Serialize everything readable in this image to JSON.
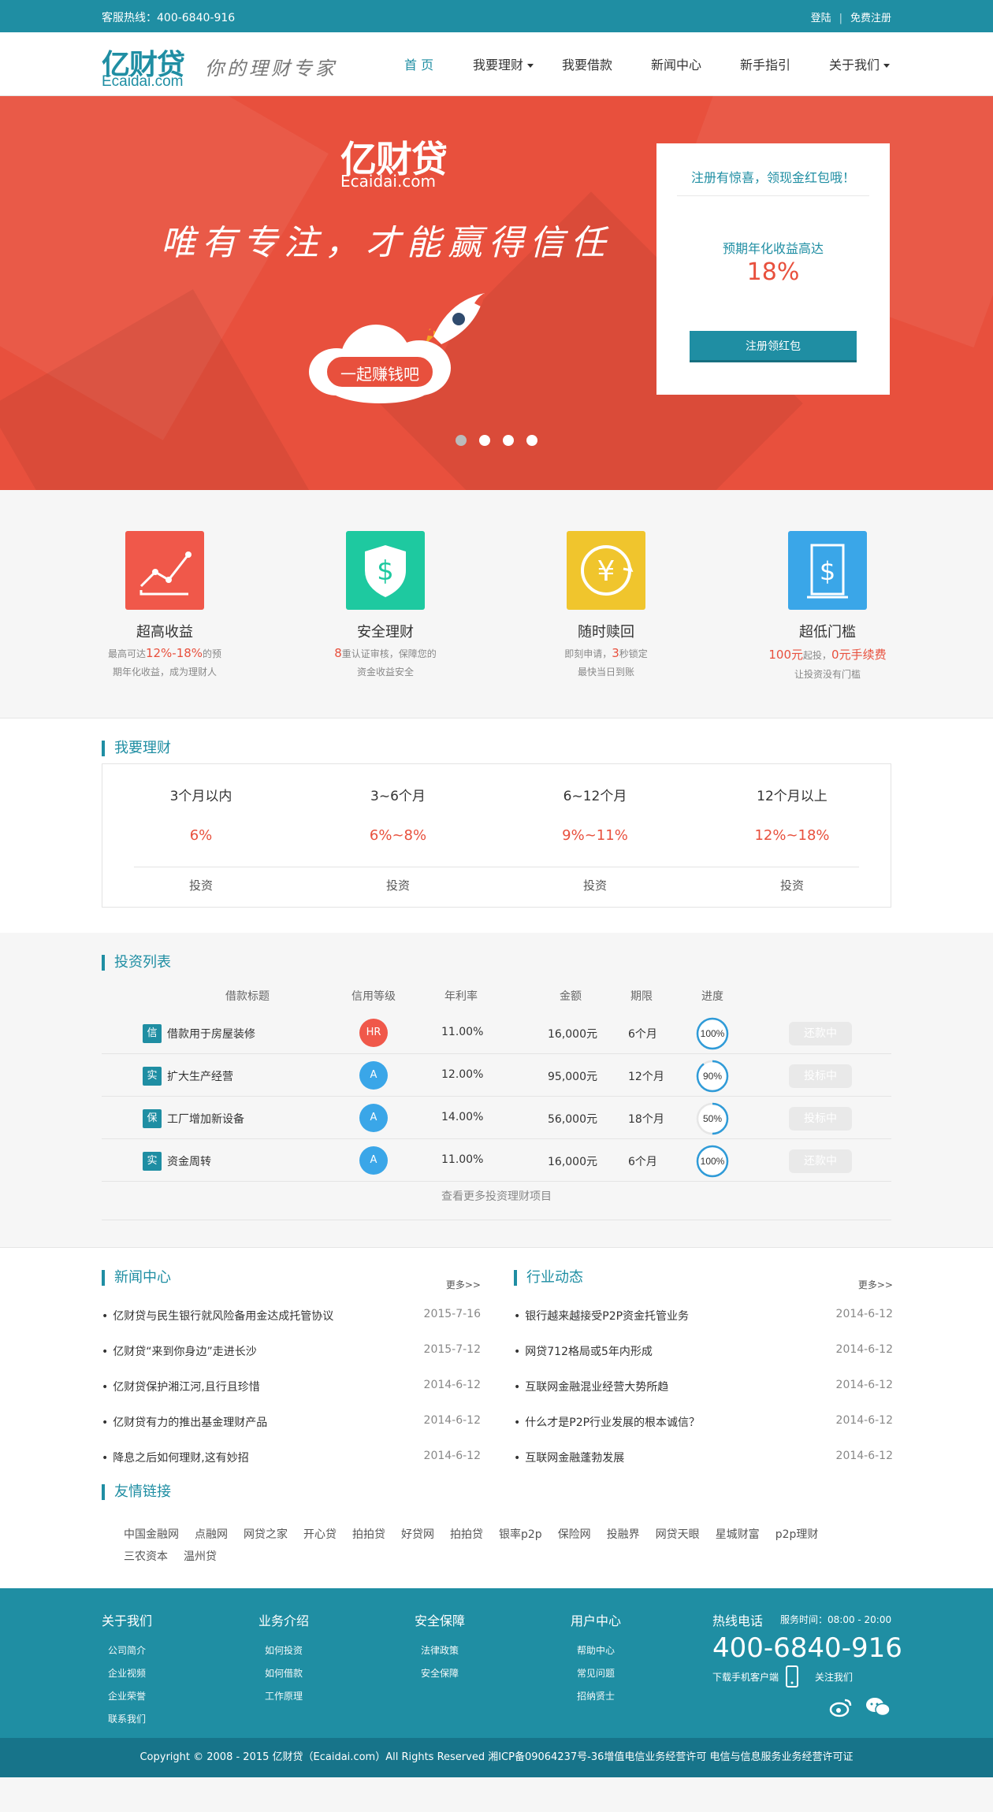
{
  "topbar": {
    "hotline": "客服热线：400-6840-916",
    "login": "登陆",
    "register": "免费注册"
  },
  "brand": {
    "name": "亿财贷",
    "domain": "Ecaidai.com",
    "slogan": "你的理财专家"
  },
  "nav": [
    {
      "label": "首 页",
      "active": true
    },
    {
      "label": "我要理财",
      "dropdown": true
    },
    {
      "label": "我要借款"
    },
    {
      "label": "新闻中心"
    },
    {
      "label": "新手指引"
    },
    {
      "label": "关于我们",
      "dropdown": true
    }
  ],
  "banner": {
    "logo": "亿财贷",
    "logo_en": "Ecaidai.com",
    "slogan": "唯有专注，才能赢得信任",
    "cta": "一起赚钱吧",
    "register_box": {
      "title": "注册有惊喜，领现金红包哦！",
      "rate_label": "预期年化收益高达",
      "rate": "18%",
      "button": "注册领红包"
    },
    "slides": 4,
    "current_slide": 1
  },
  "features": [
    {
      "title": "超高收益",
      "desc_pre": "最高可达",
      "desc_red": "12%-18%",
      "desc_post": "的预",
      "desc2": "期年化收益，成为理财人",
      "color": "#f0584a"
    },
    {
      "title": "安全理财",
      "desc_pre": "",
      "desc_red": "8",
      "desc_post": "重认证审核，保障您的",
      "desc2": "资金收益安全",
      "color": "#1ec9a0"
    },
    {
      "title": "随时赎回",
      "desc_pre": "即刻申请，",
      "desc_red": "3",
      "desc_post": "秒锁定",
      "desc2": "最快当日到账",
      "color": "#f0c52d"
    },
    {
      "title": "超低门槛",
      "desc_pre": "",
      "desc_red": "100元",
      "desc_post": "起投，",
      "desc_red2": "0元手续费",
      "desc2": "让投资没有门槛",
      "color": "#3aa6e8"
    }
  ],
  "finance": {
    "title": "我要理财",
    "products": [
      {
        "period": "3个月以内",
        "rate": "6%",
        "action": "投资"
      },
      {
        "period": "3~6个月",
        "rate": "6%~8%",
        "action": "投资"
      },
      {
        "period": "6~12个月",
        "rate": "9%~11%",
        "action": "投资"
      },
      {
        "period": "12个月以上",
        "rate": "12%~18%",
        "action": "投资"
      }
    ]
  },
  "invest": {
    "title": "投资列表",
    "headers": {
      "title": "借款标题",
      "credit": "信用等级",
      "rate": "年利率",
      "amount": "金额",
      "term": "期限",
      "progress": "进度"
    },
    "rows": [
      {
        "tag": "信",
        "name": "借款用于房屋装修",
        "credit": "HR",
        "credit_color": "#f0584a",
        "rate": "11.00%",
        "amount": "16,000元",
        "term": "6个月",
        "progress": 100,
        "progress_label": "100%",
        "action": "还款中"
      },
      {
        "tag": "实",
        "name": "扩大生产经营",
        "credit": "A",
        "credit_color": "#3aa6e8",
        "rate": "12.00%",
        "amount": "95,000元",
        "term": "12个月",
        "progress": 90,
        "progress_label": "90%",
        "action": "投标中"
      },
      {
        "tag": "保",
        "name": "工厂增加新设备",
        "credit": "A",
        "credit_color": "#3aa6e8",
        "rate": "14.00%",
        "amount": "56,000元",
        "term": "18个月",
        "progress": 50,
        "progress_label": "50%",
        "action": "投标中"
      },
      {
        "tag": "实",
        "name": "资金周转",
        "credit": "A",
        "credit_color": "#3aa6e8",
        "rate": "11.00%",
        "amount": "16,000元",
        "term": "6个月",
        "progress": 100,
        "progress_label": "100%",
        "action": "还款中"
      }
    ],
    "more": "查看更多投资理财项目"
  },
  "news": {
    "title": "新闻中心",
    "more": "更多>>",
    "items": [
      {
        "title": "亿财贷与民生银行就风险备用金达成托管协议",
        "date": "2015-7-16"
      },
      {
        "title": "亿财贷“来到你身边”走进长沙",
        "date": "2015-7-12"
      },
      {
        "title": "亿财贷保护湘江河,且行且珍惜",
        "date": "2014-6-12"
      },
      {
        "title": "亿财贷有力的推出基金理财产品",
        "date": "2014-6-12"
      },
      {
        "title": "降息之后如何理财,这有妙招",
        "date": "2014-6-12"
      }
    ]
  },
  "industry": {
    "title": "行业动态",
    "more": "更多>>",
    "items": [
      {
        "title": "银行越来越接受P2P资金托管业务",
        "date": "2014-6-12"
      },
      {
        "title": "网贷712格局或5年内形成",
        "date": "2014-6-12"
      },
      {
        "title": "互联网金融混业经营大势所趋",
        "date": "2014-6-12"
      },
      {
        "title": "什么才是P2P行业发展的根本诚信？",
        "date": "2014-6-12"
      },
      {
        "title": "互联网金融蓬勃发展",
        "date": "2014-6-12"
      }
    ]
  },
  "links": {
    "title": "友情链接",
    "items": [
      "中国金融网",
      "点融网",
      "网贷之家",
      "开心贷",
      "拍拍贷",
      "好贷网",
      "拍拍贷",
      "银率p2p",
      "保险网",
      "投融界",
      "网贷天眼",
      "星城财富",
      "p2p理财",
      "三农资本",
      "温州贷"
    ]
  },
  "footer": {
    "cols": [
      {
        "title": "关于我们",
        "links": [
          "公司简介",
          "企业视频",
          "企业荣誉",
          "联系我们"
        ]
      },
      {
        "title": "业务介绍",
        "links": [
          "如何投资",
          "如何借款",
          "工作原理"
        ]
      },
      {
        "title": "安全保障",
        "links": [
          "法律政策",
          "安全保障"
        ]
      },
      {
        "title": "用户中心",
        "links": [
          "帮助中心",
          "常见问题",
          "招纳贤士"
        ]
      }
    ],
    "hotline_title": "热线电话",
    "service_time": "服务时间：08:00 - 20:00",
    "hotline": "400-6840-916",
    "app_download": "下载手机客户端",
    "follow": "关注我们",
    "copyright": "Copyright © 2008 - 2015 亿财贷（Ecaidai.com）All Rights Reserved 湘ICP备09064237号-36增值电信业务经营许可  电信与信息服务业务经营许可证"
  }
}
